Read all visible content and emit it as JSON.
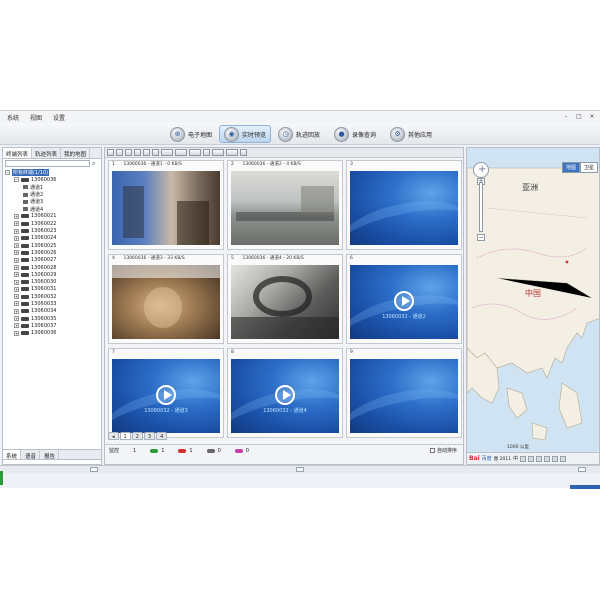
{
  "menu": [
    "系统",
    "视图",
    "设置"
  ],
  "toolbar": [
    {
      "label": "电子地图",
      "icon": "map-icon"
    },
    {
      "label": "实时预览",
      "icon": "camera-icon",
      "active": true
    },
    {
      "label": "轨迹回放",
      "icon": "track-icon"
    },
    {
      "label": "录像查询",
      "icon": "record-icon"
    },
    {
      "label": "其他应用",
      "icon": "gear-icon"
    }
  ],
  "left_tabs": [
    "终端列表",
    "轨迹列表",
    "我的地图"
  ],
  "tree": {
    "root": "所有终端(1/10)",
    "vehicle": "13060036",
    "channels": [
      "通道1",
      "通道2",
      "通道3",
      "通道4"
    ],
    "others": [
      "13060021",
      "13060022",
      "13060023",
      "13060024",
      "13060025",
      "13060026",
      "13060027",
      "13060028",
      "13060029",
      "13060030",
      "13060031",
      "13060032",
      "13060033",
      "13060034",
      "13060035",
      "13060037",
      "13060036"
    ]
  },
  "left_bottom_tabs": [
    "系统",
    "语音",
    "报告"
  ],
  "cells": [
    {
      "num": "1",
      "info": "13060036 - 通道1 - 0 KB/S",
      "type": "cam1"
    },
    {
      "num": "2",
      "info": "13060036 - 通道2 - 4 KB/S",
      "type": "cam2"
    },
    {
      "num": "3",
      "info": "",
      "type": "blue"
    },
    {
      "num": "4",
      "info": "13060036 - 通道3 - 33 KB/S",
      "type": "cam4"
    },
    {
      "num": "5",
      "info": "13060036 - 通道4 - 20 KB/S",
      "type": "cam5"
    },
    {
      "num": "6",
      "info": "",
      "type": "play",
      "label": "13060032 - 通道2"
    },
    {
      "num": "7",
      "info": "",
      "type": "play",
      "label": "13060032 - 通道3"
    },
    {
      "num": "8",
      "info": "",
      "type": "play",
      "label": "13060032 - 通道4"
    },
    {
      "num": "9",
      "info": "",
      "type": "blue"
    }
  ],
  "page_tabs": [
    "1",
    "2",
    "3",
    "4"
  ],
  "status": {
    "label": "监控",
    "count1": "1",
    "count2": "1",
    "count3": "1",
    "count4": "0",
    "count5": "0",
    "auto_sort": "自动排序"
  },
  "map": {
    "types": [
      "地图",
      "卫星"
    ],
    "labels": {
      "asia": "亚洲",
      "china": "中国"
    },
    "scale": "1000 公里",
    "logo": "Bai",
    "logo2": "百度",
    "copyright": "图 2011",
    "bar_char": "中"
  },
  "colors": {
    "accent": "#3569b8",
    "video_blue": "#2d6fc9",
    "car_green": "#2d9a3b",
    "car_red": "#d0312d",
    "car_gray": "#666666",
    "car_pink": "#c23ea0"
  }
}
